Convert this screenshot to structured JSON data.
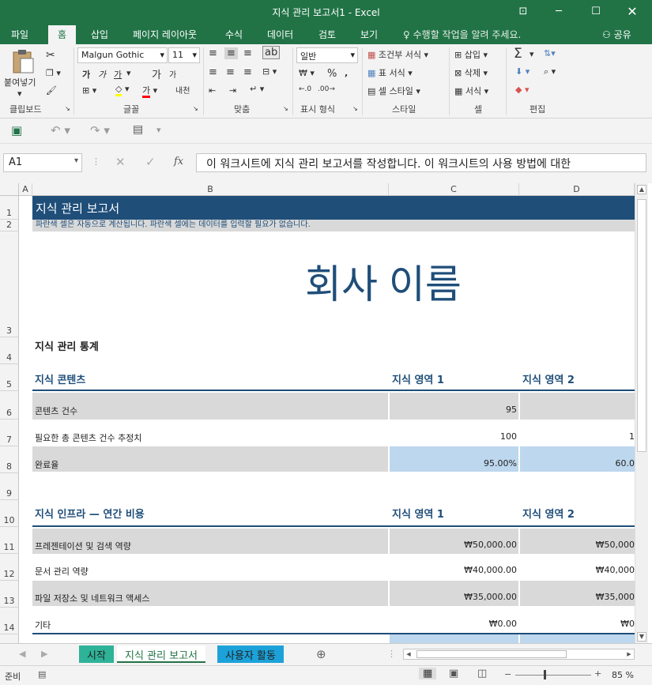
{
  "window": {
    "title": "지식 관리 보고서1 - Excel"
  },
  "ribbon_tabs": [
    "파일",
    "홈",
    "삽입",
    "페이지 레이아웃",
    "수식",
    "데이터",
    "검토",
    "보기"
  ],
  "tell_me": "수행할 작업을 알려 주세요.",
  "share": "공유",
  "ribbon": {
    "paste": "붙여넣기",
    "font_name": "Malgun Gothic",
    "font_size": "11",
    "number_format": "일반",
    "conditional_format": "조건부 서식",
    "table_format": "표 서식",
    "cell_style": "셀 스타일",
    "insert": "삽입",
    "delete": "삭제",
    "format": "서식",
    "group_labels": {
      "clipboard": "클립보드",
      "font": "글꼴",
      "alignment": "맞춤",
      "number": "표시 형식",
      "styles": "스타일",
      "cells": "셀",
      "editing": "편집"
    },
    "bold": "가",
    "italic": "가",
    "underline": "가",
    "grow": "가",
    "shrink": "가",
    "phonetic": "내천",
    "font_color": "가"
  },
  "formula_bar": {
    "name_box": "A1",
    "formula": "이 워크시트에 지식 관리 보고서를 작성합니다. 이 워크시트의 사용 방법에 대한"
  },
  "columns": [
    "A",
    "B",
    "C",
    "D"
  ],
  "rows": [
    "1",
    "2",
    "3",
    "4",
    "5",
    "6",
    "7",
    "8",
    "9",
    "10",
    "11",
    "12",
    "13",
    "14"
  ],
  "sheet": {
    "title": "지식 관리 보고서",
    "subtitle": "파란색 셀은 자동으로 계산됩니다. 파란색 셀에는 데이터를 입력할 필요가 없습니다.",
    "company": "회사 이름",
    "stats_header": "지식 관리 통계",
    "content_header": "지식 콘텐츠",
    "area1": "지식 영역 1",
    "area2": "지식 영역 2",
    "content_rows": [
      {
        "label": "콘텐츠 건수",
        "c": "95",
        "d": ""
      },
      {
        "label": "필요한 총 콘텐츠 건수 추정치",
        "c": "100",
        "d": "1"
      },
      {
        "label": "완료율",
        "c": "95.00%",
        "d": "60.0"
      }
    ],
    "infra_header": "지식 인프라 — 연간 비용",
    "infra_rows": [
      {
        "label": "프레젠테이션 및 검색 역량",
        "c": "₩50,000.00",
        "d": "₩50,000"
      },
      {
        "label": "문서 관리 역량",
        "c": "₩40,000.00",
        "d": "₩40,000"
      },
      {
        "label": "파일 저장소 및 네트워크 액세스",
        "c": "₩35,000.00",
        "d": "₩35,000"
      },
      {
        "label": "기타",
        "c": "₩0.00",
        "d": "₩0"
      }
    ]
  },
  "sheet_tabs": [
    "시작",
    "지식 관리 보고서",
    "사용자 활동"
  ],
  "status": {
    "ready": "준비",
    "zoom": "85 %"
  },
  "colors": {
    "excel_green": "#217346",
    "title_blue": "#1f4e79",
    "gray_band": "#d9d9d9",
    "calc_blue": "#bdd7ee",
    "tab_teal": "#2eb398",
    "tab_cyan": "#1ca2d9"
  }
}
